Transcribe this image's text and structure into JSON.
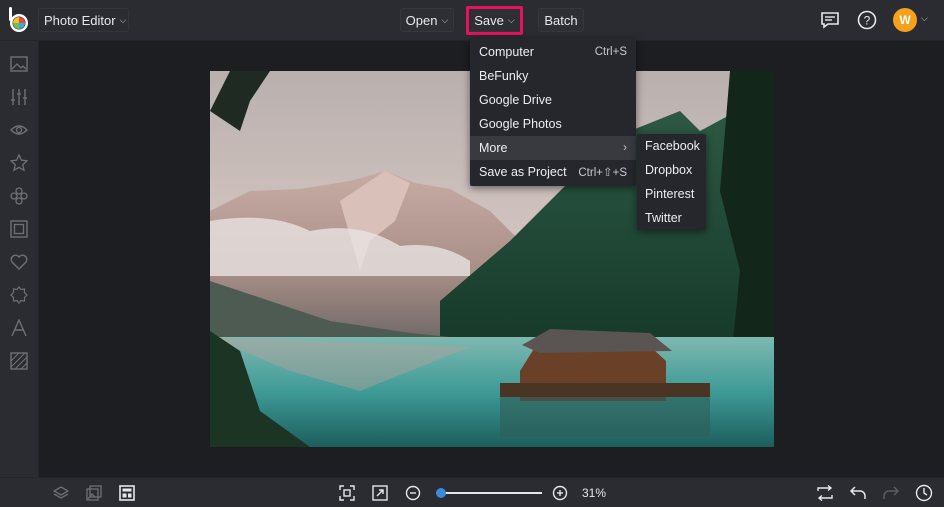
{
  "header": {
    "app_title": "Photo Editor",
    "open_label": "Open",
    "save_label": "Save",
    "batch_label": "Batch",
    "avatar_initial": "W",
    "icons": [
      "feedback-icon",
      "help-icon"
    ]
  },
  "save_menu": {
    "items": [
      {
        "label": "Computer",
        "shortcut": "Ctrl+S"
      },
      {
        "label": "BeFunky",
        "shortcut": ""
      },
      {
        "label": "Google Drive",
        "shortcut": ""
      },
      {
        "label": "Google Photos",
        "shortcut": ""
      },
      {
        "label": "More",
        "shortcut": "›"
      },
      {
        "label": "Save as Project",
        "shortcut": "Ctrl+⇧+S"
      }
    ],
    "more_submenu": [
      "Facebook",
      "Dropbox",
      "Pinterest",
      "Twitter"
    ]
  },
  "sidebar": {
    "icons": [
      "image-manager-icon",
      "adjustments-icon",
      "touch-up-icon",
      "effects-icon",
      "artsy-icon",
      "frames-icon",
      "graphics-icon",
      "overlays-icon",
      "text-icon",
      "textures-icon"
    ]
  },
  "footer": {
    "zoom_value": "31%",
    "zoom_level": 0.05,
    "icons": [
      "layers-icon",
      "image-manager-icon",
      "layout-icon",
      "fit-screen-icon",
      "actual-size-icon",
      "zoom-out-icon",
      "zoom-in-icon",
      "compare-icon",
      "undo-icon",
      "redo-icon",
      "history-icon"
    ]
  },
  "colors": {
    "accent": "#3b8ad9",
    "highlight": "#e6125d",
    "avatar": "#f7a01b"
  }
}
